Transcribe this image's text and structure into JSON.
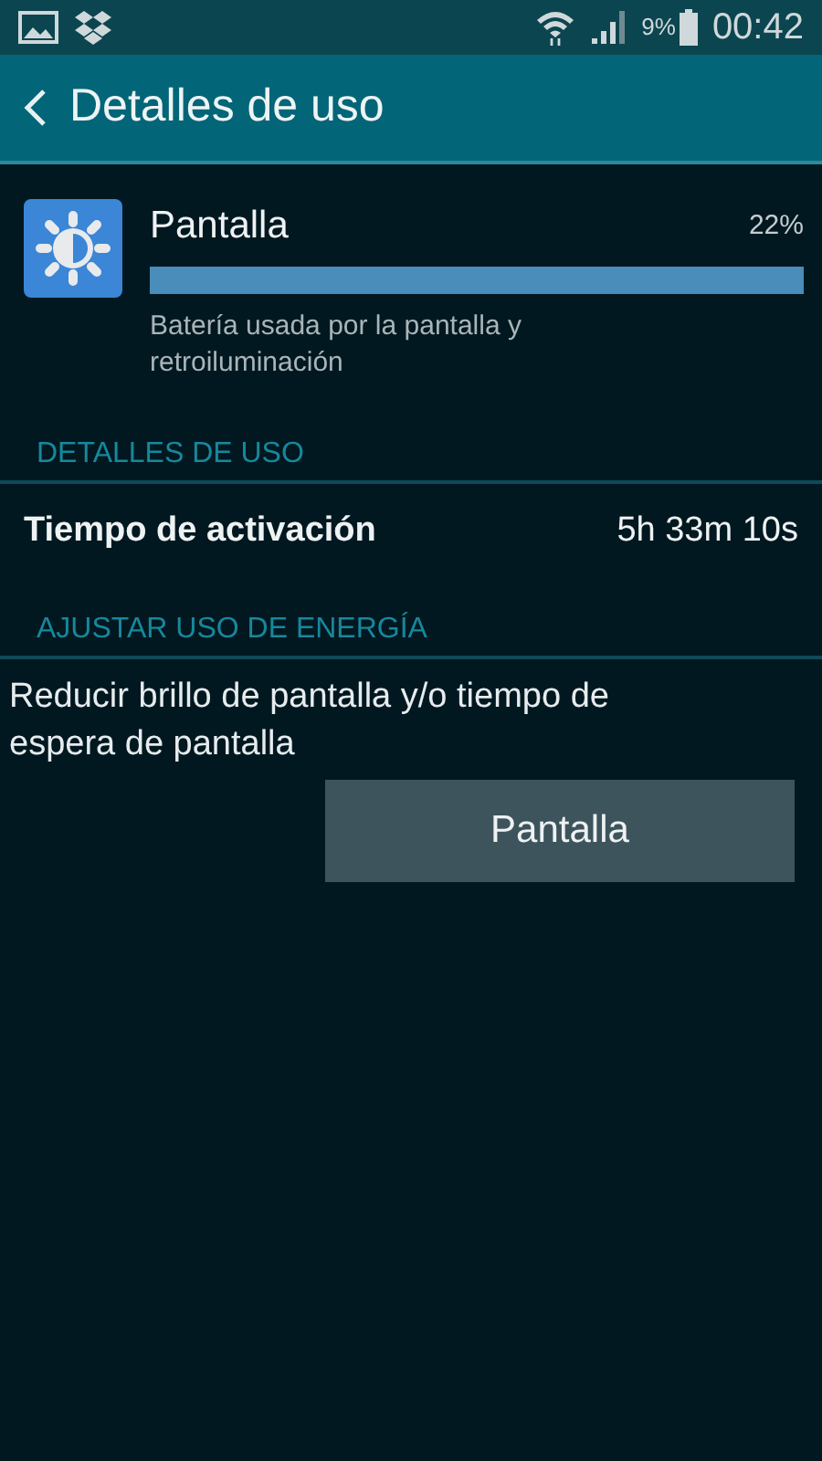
{
  "status_bar": {
    "battery_percent": "9%",
    "time": "00:42"
  },
  "header": {
    "title": "Detalles de uso"
  },
  "usage": {
    "name": "Pantalla",
    "percent": "22%",
    "level": 1,
    "description": "Batería usada por la pantalla y retroiluminación"
  },
  "sections": [
    {
      "heading": "DETALLES DE USO",
      "kind": "detail",
      "label": "Tiempo de activación",
      "value": "5h 33m 10s"
    },
    {
      "heading": "AJUSTAR USO DE ENERGÍA",
      "kind": "action",
      "text": "Reducir brillo de pantalla y/o tiempo de espera de pantalla",
      "button": "Pantalla"
    }
  ]
}
